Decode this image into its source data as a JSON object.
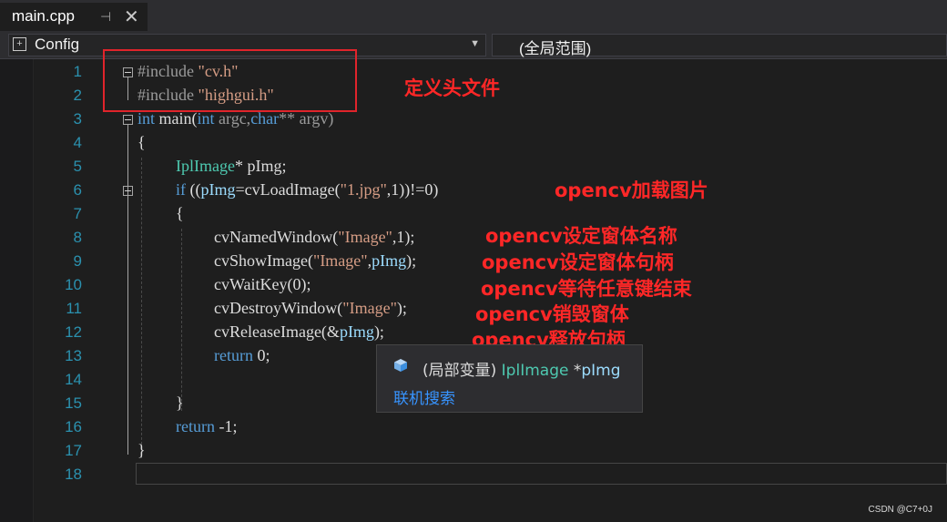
{
  "tab": {
    "title": "main.cpp",
    "pin_glyph": "⊣",
    "close_glyph": "✕"
  },
  "navbar": {
    "config_label": "Config",
    "scope_label": "(全局范围)"
  },
  "line_numbers": [
    "1",
    "2",
    "3",
    "4",
    "5",
    "6",
    "7",
    "8",
    "9",
    "10",
    "11",
    "12",
    "13",
    "14",
    "15",
    "16",
    "17",
    "18"
  ],
  "code": {
    "l1_pp": "#include ",
    "l1_str": "\"cv.h\"",
    "l2_pp": "#include ",
    "l2_str": "\"highgui.h\"",
    "l3_int": "int",
    "l3_main": " main(",
    "l3_int2": "int",
    "l3_argc": " argc,",
    "l3_char": "char",
    "l3_rest": "** argv)",
    "l4": "{",
    "l5_type": "IplImage",
    "l5_rest": "* pImg;",
    "l6_if": "if",
    "l6_a": " ((",
    "l6_pimg": "pImg",
    "l6_b": "=cvLoadImage(",
    "l6_str": "\"1.jpg\"",
    "l6_c": ",1))!=0)",
    "l7": "{",
    "l8_a": "cvNamedWindow(",
    "l8_str": "\"Image\"",
    "l8_b": ",1);",
    "l9_a": "cvShowImage(",
    "l9_str": "\"Image\"",
    "l9_b": ",",
    "l9_pimg": "pImg",
    "l9_c": ");",
    "l10": "cvWaitKey(0);",
    "l11_a": "cvDestroyWindow(",
    "l11_str": "\"Image\"",
    "l11_b": ");",
    "l12_a": "cvReleaseImage(&",
    "l12_pimg": "pImg",
    "l12_b": ");",
    "l13_kw": "return",
    "l13_rest": " 0;",
    "l15": "}",
    "l16_kw": "return",
    "l16_rest": " -1;",
    "l17": "}"
  },
  "annotations": {
    "header": "定义头文件",
    "load": "opencv加载图片",
    "set_name": "opencv设定窗体名称",
    "set_handle": "opencv设定窗体句柄",
    "wait": "opencv等待任意键结束",
    "destroy": "opencv销毁窗体",
    "release": "opencv释放句柄"
  },
  "tooltip": {
    "prefix": "(局部变量) ",
    "type": "IplImage",
    "star": " *",
    "var": "pImg",
    "link": "联机搜索"
  },
  "watermark": "CSDN @C7+0J",
  "colors": {
    "keyword": "#569cd6",
    "type": "#4ec9b0",
    "string": "#d69d85",
    "line_number": "#2b91af",
    "annotation": "#ff2727"
  }
}
